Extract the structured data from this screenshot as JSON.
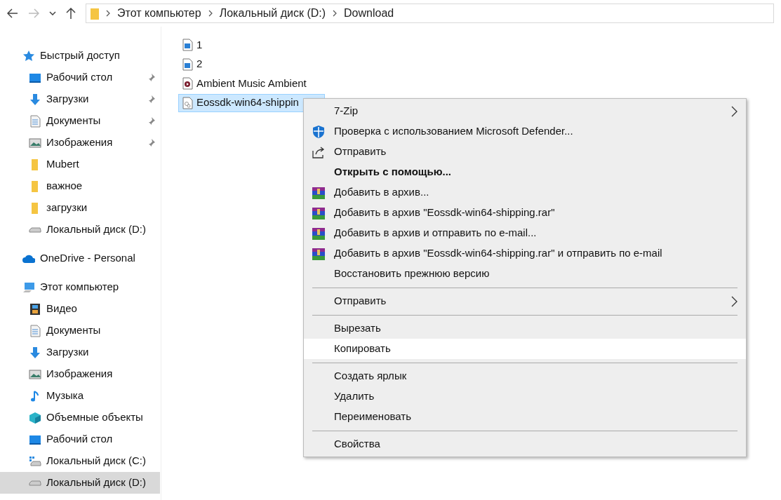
{
  "toolbar": {
    "breadcrumb": [
      "Этот компьютер",
      "Локальный диск (D:)",
      "Download"
    ]
  },
  "sidebar": {
    "groups": [
      {
        "kind": "star",
        "label": "Быстрый доступ",
        "selected": false,
        "children": [
          {
            "kind": "desktop",
            "label": "Рабочий стол",
            "pinned": true,
            "selected": false
          },
          {
            "kind": "download",
            "label": "Загрузки",
            "pinned": true,
            "selected": false
          },
          {
            "kind": "document",
            "label": "Документы",
            "pinned": true,
            "selected": false
          },
          {
            "kind": "picture",
            "label": "Изображения",
            "pinned": true,
            "selected": false
          },
          {
            "kind": "folder",
            "label": "Mubert",
            "pinned": false,
            "selected": false
          },
          {
            "kind": "folder",
            "label": "важное",
            "pinned": false,
            "selected": false
          },
          {
            "kind": "folder",
            "label": "загрузки",
            "pinned": false,
            "selected": false
          },
          {
            "kind": "drive",
            "label": "Локальный диск (D:)",
            "pinned": false,
            "selected": false
          }
        ]
      },
      {
        "kind": "cloud",
        "label": "OneDrive - Personal",
        "selected": false
      },
      {
        "kind": "computer",
        "label": "Этот компьютер",
        "selected": false,
        "children": [
          {
            "kind": "video",
            "label": "Видео",
            "pinned": false,
            "selected": false
          },
          {
            "kind": "document",
            "label": "Документы",
            "pinned": false,
            "selected": false
          },
          {
            "kind": "download",
            "label": "Загрузки",
            "pinned": false,
            "selected": false
          },
          {
            "kind": "picture",
            "label": "Изображения",
            "pinned": false,
            "selected": false
          },
          {
            "kind": "music",
            "label": "Музыка",
            "pinned": false,
            "selected": false
          },
          {
            "kind": "cube",
            "label": "Объемные объекты",
            "pinned": false,
            "selected": false
          },
          {
            "kind": "desktop",
            "label": "Рабочий стол",
            "pinned": false,
            "selected": false
          },
          {
            "kind": "windrive",
            "label": "Локальный диск (C:)",
            "pinned": false,
            "selected": false
          },
          {
            "kind": "drive",
            "label": "Локальный диск (D:)",
            "pinned": false,
            "selected": true
          }
        ]
      }
    ]
  },
  "files": [
    {
      "kind": "image",
      "name": "1",
      "selected": false
    },
    {
      "kind": "image",
      "name": "2",
      "selected": false
    },
    {
      "kind": "media",
      "name": "Ambient Music Ambient",
      "selected": false
    },
    {
      "kind": "settings",
      "name": "Eossdk-win64-shippin",
      "selected": true
    }
  ],
  "context_menu": [
    {
      "kind": "plain",
      "label": "7-Zip",
      "submenu": true,
      "bold": false,
      "selected": false
    },
    {
      "kind": "shield",
      "label": "Проверка с использованием Microsoft Defender...",
      "submenu": false,
      "bold": false,
      "selected": false
    },
    {
      "kind": "share",
      "label": "Отправить",
      "submenu": false,
      "bold": false,
      "selected": false
    },
    {
      "kind": "plain",
      "label": "Открыть с помощью...",
      "submenu": false,
      "bold": true,
      "selected": false
    },
    {
      "kind": "archive",
      "label": "Добавить в архив...",
      "submenu": false,
      "bold": false,
      "selected": false
    },
    {
      "kind": "archive",
      "label": "Добавить в архив \"Eossdk-win64-shipping.rar\"",
      "submenu": false,
      "bold": false,
      "selected": false
    },
    {
      "kind": "archive",
      "label": "Добавить в архив и отправить по e-mail...",
      "submenu": false,
      "bold": false,
      "selected": false
    },
    {
      "kind": "archive",
      "label": "Добавить в архив \"Eossdk-win64-shipping.rar\" и отправить по e-mail",
      "submenu": false,
      "bold": false,
      "selected": false
    },
    {
      "kind": "plain",
      "label": "Восстановить прежнюю версию",
      "submenu": false,
      "bold": false,
      "selected": false
    },
    {
      "kind": "separator"
    },
    {
      "kind": "plain",
      "label": "Отправить",
      "submenu": true,
      "bold": false,
      "selected": false
    },
    {
      "kind": "separator"
    },
    {
      "kind": "plain",
      "label": "Вырезать",
      "submenu": false,
      "bold": false,
      "selected": false
    },
    {
      "kind": "plain",
      "label": "Копировать",
      "submenu": false,
      "bold": false,
      "selected": true
    },
    {
      "kind": "separator"
    },
    {
      "kind": "plain",
      "label": "Создать ярлык",
      "submenu": false,
      "bold": false,
      "selected": false
    },
    {
      "kind": "plain",
      "label": "Удалить",
      "submenu": false,
      "bold": false,
      "selected": false
    },
    {
      "kind": "plain",
      "label": "Переименовать",
      "submenu": false,
      "bold": false,
      "selected": false
    },
    {
      "kind": "separator"
    },
    {
      "kind": "plain",
      "label": "Свойства",
      "submenu": false,
      "bold": false,
      "selected": false
    }
  ]
}
